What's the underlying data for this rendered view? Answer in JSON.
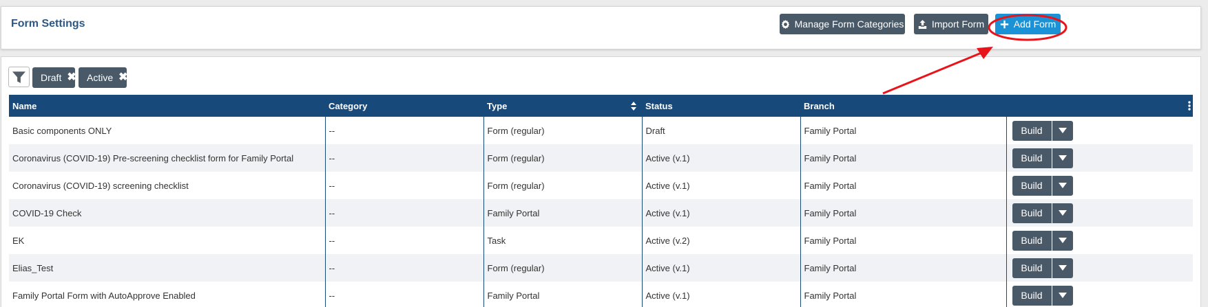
{
  "header": {
    "title": "Form Settings",
    "buttons": {
      "manage_categories": "Manage Form Categories",
      "import_form": "Import Form",
      "add_form": "Add Form"
    }
  },
  "filters": {
    "icon": "filter-icon",
    "chips": [
      "Draft",
      "Active"
    ]
  },
  "table": {
    "columns": [
      "Name",
      "Category",
      "Type",
      "Status",
      "Branch"
    ],
    "rows": [
      {
        "name": "Basic components ONLY",
        "category": "--",
        "type": "Form (regular)",
        "status": "Draft",
        "branch": "Family Portal",
        "action": "Build"
      },
      {
        "name": "Coronavirus (COVID-19) Pre-screening checklist form for Family Portal",
        "category": "--",
        "type": "Form (regular)",
        "status": "Active (v.1)",
        "branch": "Family Portal",
        "action": "Build"
      },
      {
        "name": "Coronavirus (COVID-19) screening checklist",
        "category": "--",
        "type": "Form (regular)",
        "status": "Active (v.1)",
        "branch": "Family Portal",
        "action": "Build"
      },
      {
        "name": "COVID-19 Check",
        "category": "--",
        "type": "Family Portal",
        "status": "Active (v.1)",
        "branch": "Family Portal",
        "action": "Build"
      },
      {
        "name": "EK",
        "category": "--",
        "type": "Task",
        "status": "Active (v.2)",
        "branch": "Family Portal",
        "action": "Build"
      },
      {
        "name": "Elias_Test",
        "category": "--",
        "type": "Form (regular)",
        "status": "Active (v.1)",
        "branch": "Family Portal",
        "action": "Build"
      },
      {
        "name": "Family Portal Form with AutoApprove Enabled",
        "category": "--",
        "type": "Family Portal",
        "status": "Active (v.1)",
        "branch": "Family Portal",
        "action": "Build"
      }
    ]
  },
  "colors": {
    "title": "#2d5786",
    "dark_button": "#4a5968",
    "primary_button": "#1c92d6",
    "table_header": "#17497b",
    "annotation": "#e8141a"
  }
}
